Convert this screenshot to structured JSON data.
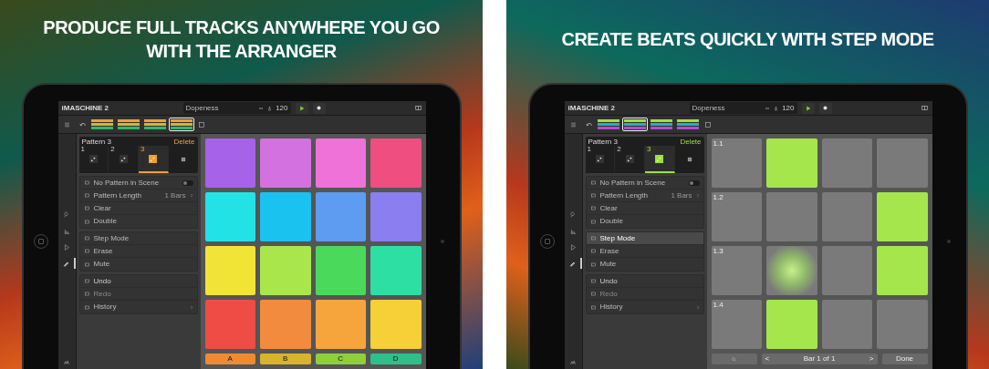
{
  "panels": [
    {
      "headline": [
        "PRODUCE FULL TRACKS ANYWHERE YOU GO",
        "WITH THE ARRANGER"
      ],
      "app": {
        "brand": "iMASCHINE 2",
        "project": "Dopeness",
        "tempo": "120",
        "arranger": {
          "tracks": [
            {
              "color": "#f0a030"
            },
            {
              "color": "#d8b23a"
            },
            {
              "color": "#2fb86a"
            }
          ],
          "scenes": [
            {
              "selected": false
            },
            {
              "selected": false
            },
            {
              "selected": false
            },
            {
              "selected": true
            }
          ]
        },
        "tool_rail": [
          {
            "selected": false
          },
          {
            "selected": false
          },
          {
            "selected": false
          },
          {
            "selected": true
          }
        ],
        "pattern_title": "Pattern 3",
        "delete": "Delete",
        "patterns": [
          {
            "number": "1",
            "selected": false
          },
          {
            "number": "2",
            "selected": false
          },
          {
            "number": "3",
            "selected": true
          }
        ],
        "menu_groups": [
          [
            {
              "kind": "toggle",
              "label": "No Pattern in Scene",
              "on": false
            },
            {
              "kind": "link",
              "label": "Pattern Length",
              "value": "1 Bars"
            },
            {
              "kind": "action",
              "label": "Clear"
            },
            {
              "kind": "action",
              "label": "Double"
            }
          ],
          [
            {
              "kind": "mode",
              "label": "Step Mode",
              "selected": false
            },
            {
              "kind": "mode",
              "label": "Erase",
              "selected": false
            },
            {
              "kind": "mode",
              "label": "Mute",
              "selected": false
            }
          ],
          [
            {
              "kind": "history",
              "label": "Undo",
              "disabled": false
            },
            {
              "kind": "history",
              "label": "Redo",
              "disabled": true
            },
            {
              "kind": "link",
              "label": "History"
            }
          ]
        ],
        "view": {
          "kind": "pads",
          "pads": [
            {
              "color": "#a662e8"
            },
            {
              "color": "#d471e0"
            },
            {
              "color": "#ef72d9"
            },
            {
              "color": "#ee4e80"
            },
            {
              "color": "#22e2e6"
            },
            {
              "color": "#1ac2ef"
            },
            {
              "color": "#5d9cf0"
            },
            {
              "color": "#8a7ef0"
            },
            {
              "color": "#f2e437"
            },
            {
              "color": "#a9e64c"
            },
            {
              "color": "#4bd95c"
            },
            {
              "color": "#2ddfa2"
            },
            {
              "color": "#ef4c46"
            },
            {
              "color": "#f28b3e"
            },
            {
              "color": "#f5a53c"
            },
            {
              "color": "#f5d037"
            }
          ],
          "groups": [
            {
              "label": "A",
              "color": "#f08a30"
            },
            {
              "label": "B",
              "color": "#d8b32c"
            },
            {
              "label": "C",
              "color": "#8ecf3a"
            },
            {
              "label": "D",
              "color": "#2fbf8a"
            }
          ]
        }
      }
    },
    {
      "headline": [
        "CREATE BEATS QUICKLY WITH STEP MODE"
      ],
      "app": {
        "brand": "iMASCHINE 2",
        "project": "Dopeness",
        "tempo": "120",
        "arranger": {
          "tracks": [
            {
              "color": "#9ee03a"
            },
            {
              "color": "#27b0b8"
            },
            {
              "color": "#b04fd0"
            }
          ],
          "scenes": [
            {
              "selected": false
            },
            {
              "selected": true
            },
            {
              "selected": false
            },
            {
              "selected": false
            }
          ]
        },
        "tool_rail": [
          {
            "selected": false
          },
          {
            "selected": false
          },
          {
            "selected": false
          },
          {
            "selected": true
          }
        ],
        "pattern_title": "Pattern 3",
        "delete": "Delete",
        "patterns": [
          {
            "number": "1",
            "selected": false
          },
          {
            "number": "2",
            "selected": false
          },
          {
            "number": "3",
            "selected": true
          }
        ],
        "menu_groups": [
          [
            {
              "kind": "toggle",
              "label": "No Pattern in Scene",
              "on": false
            },
            {
              "kind": "link",
              "label": "Pattern Length",
              "value": "1 Bars"
            },
            {
              "kind": "action",
              "label": "Clear"
            },
            {
              "kind": "action",
              "label": "Double"
            }
          ],
          [
            {
              "kind": "mode",
              "label": "Step Mode",
              "selected": true
            },
            {
              "kind": "mode",
              "label": "Erase",
              "selected": false
            },
            {
              "kind": "mode",
              "label": "Mute",
              "selected": false
            }
          ],
          [
            {
              "kind": "history",
              "label": "Undo",
              "disabled": false
            },
            {
              "kind": "history",
              "label": "Redo",
              "disabled": true
            },
            {
              "kind": "link",
              "label": "History"
            }
          ]
        ],
        "view": {
          "kind": "steps",
          "rows": [
            {
              "label": "1.1",
              "steps": [
                {
                  "on": false,
                  "playhead": false
                },
                {
                  "on": true,
                  "playhead": false
                },
                {
                  "on": false,
                  "playhead": false
                },
                {
                  "on": false,
                  "playhead": false
                }
              ]
            },
            {
              "label": "1.2",
              "steps": [
                {
                  "on": false,
                  "playhead": false
                },
                {
                  "on": false,
                  "playhead": false
                },
                {
                  "on": false,
                  "playhead": false
                },
                {
                  "on": true,
                  "playhead": false
                }
              ]
            },
            {
              "label": "1.3",
              "steps": [
                {
                  "on": false,
                  "playhead": false
                },
                {
                  "on": false,
                  "playhead": true
                },
                {
                  "on": false,
                  "playhead": false
                },
                {
                  "on": true,
                  "playhead": false
                }
              ]
            },
            {
              "label": "1.4",
              "steps": [
                {
                  "on": false,
                  "playhead": false
                },
                {
                  "on": true,
                  "playhead": false
                },
                {
                  "on": false,
                  "playhead": false
                },
                {
                  "on": false,
                  "playhead": false
                }
              ]
            }
          ],
          "footer": {
            "prev": "<",
            "position": "Bar 1 of 1",
            "next": ">",
            "done": "Done"
          }
        }
      }
    }
  ]
}
